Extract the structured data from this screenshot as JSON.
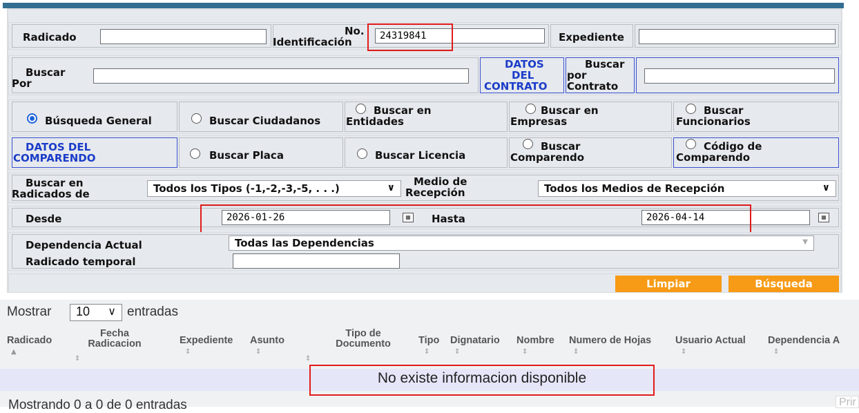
{
  "form": {
    "row1": {
      "radicado_label": "Radicado",
      "radicado_value": "",
      "no_label": "No.",
      "identificacion_label": "Identificación",
      "identificacion_value": "24319841",
      "expediente_label": "Expediente",
      "expediente_value": ""
    },
    "row2": {
      "buscar_label": "Buscar",
      "por_label": "Por",
      "buscar_por_value": "",
      "datos_contrato_l1": "DATOS",
      "datos_contrato_l2": "DEL",
      "datos_contrato_l3": "CONTRATO",
      "buscar_contrato_l1": "Buscar",
      "buscar_contrato_l2": "por",
      "buscar_contrato_l3": "Contrato",
      "buscar_contrato_value": ""
    },
    "row3": {
      "opt1": "Búsqueda General",
      "opt2": "Buscar Ciudadanos",
      "opt3_l1": "Buscar en",
      "opt3_l2": "Entidades",
      "opt4_l1": "Buscar en",
      "opt4_l2": "Empresas",
      "opt5_l1": "Buscar",
      "opt5_l2": "Funcionarios",
      "selected": "Búsqueda General"
    },
    "row4": {
      "datos_comparendo_l1": "DATOS DEL",
      "datos_comparendo_l2": "COMPARENDO",
      "opt1": "Buscar Placa",
      "opt2": "Buscar Licencia",
      "opt3_l1": "Buscar",
      "opt3_l2": "Comparendo",
      "opt4_l1": "Código de",
      "opt4_l2": "Comparendo"
    },
    "row5": {
      "buscar_en_l1": "Buscar en",
      "buscar_en_l2": "Radicados de",
      "tipos_value": "Todos los Tipos (-1,-2,-3,-5, . . .)",
      "medio_l1": "Medio de",
      "medio_l2": "Recepción",
      "medio_value": "Todos los Medios de Recepción"
    },
    "row6": {
      "desde_label": "Desde",
      "desde_value": "2026-01-26",
      "hasta_label": "Hasta",
      "hasta_value": "2026-04-14"
    },
    "row7": {
      "dependencia_label": "Dependencia Actual",
      "dependencia_value": "Todas las Dependencias",
      "temporal_label": "Radicado temporal",
      "temporal_value": ""
    },
    "buttons": {
      "limpiar": "Limpiar",
      "busqueda": "Búsqueda"
    }
  },
  "table": {
    "mostrar_label": "Mostrar",
    "page_size": "10",
    "entradas_label": "entradas",
    "columns": [
      "Radicado",
      "Fecha Radicacion",
      "Expediente",
      "Asunto",
      "Tipo de Documento",
      "Tipo",
      "Dignatario",
      "Nombre",
      "Numero de Hojas",
      "Usuario Actual",
      "Dependencia A"
    ],
    "empty_message": "No existe informacion disponible",
    "footer_info": "Mostrando 0 a 0 de 0 entradas",
    "pager_first": "Prir"
  },
  "colors": {
    "header_bar": "#336e92",
    "button": "#f79a15",
    "highlight": "#e01b1b",
    "radio_selected": "#1e64d8"
  }
}
